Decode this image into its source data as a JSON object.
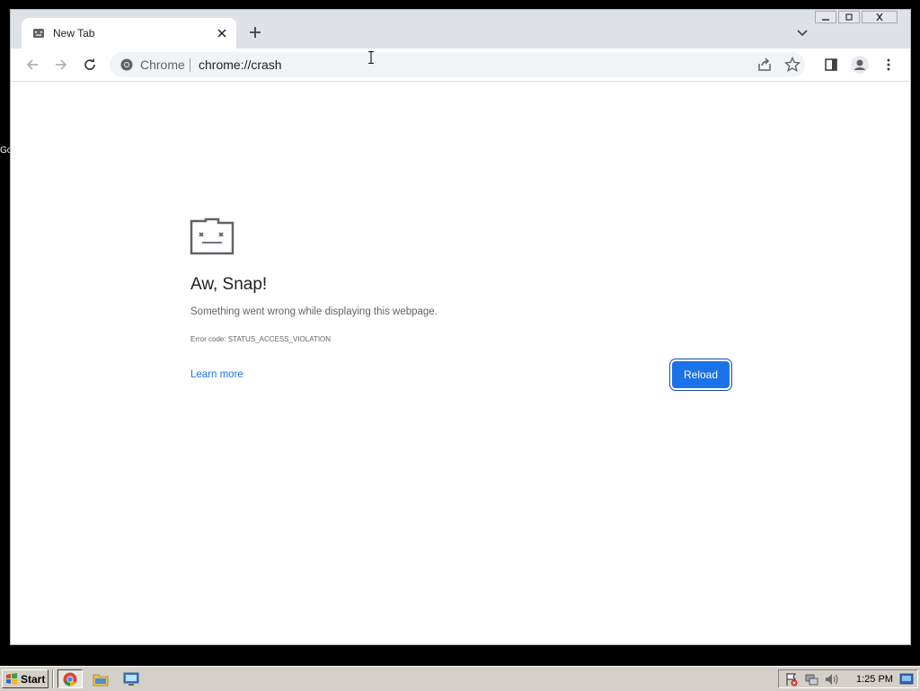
{
  "browser": {
    "tab": {
      "title": "New Tab",
      "close_icon": "close-icon"
    },
    "new_tab_icon": "plus-icon",
    "tab_search_icon": "chevron-down-icon",
    "omnibox": {
      "chip": "Chrome",
      "url": "chrome://crash"
    }
  },
  "crash_page": {
    "title": "Aw, Snap!",
    "message": "Something went wrong while displaying this webpage.",
    "error_code": "Error code: STATUS_ACCESS_VIOLATION",
    "learn_more": "Learn more",
    "reload_label": "Reload",
    "accent_color": "#1a73e8"
  },
  "taskbar": {
    "start_label": "Start",
    "clock": "1:25 PM"
  },
  "desktop": {
    "edge_text": "Gc"
  }
}
